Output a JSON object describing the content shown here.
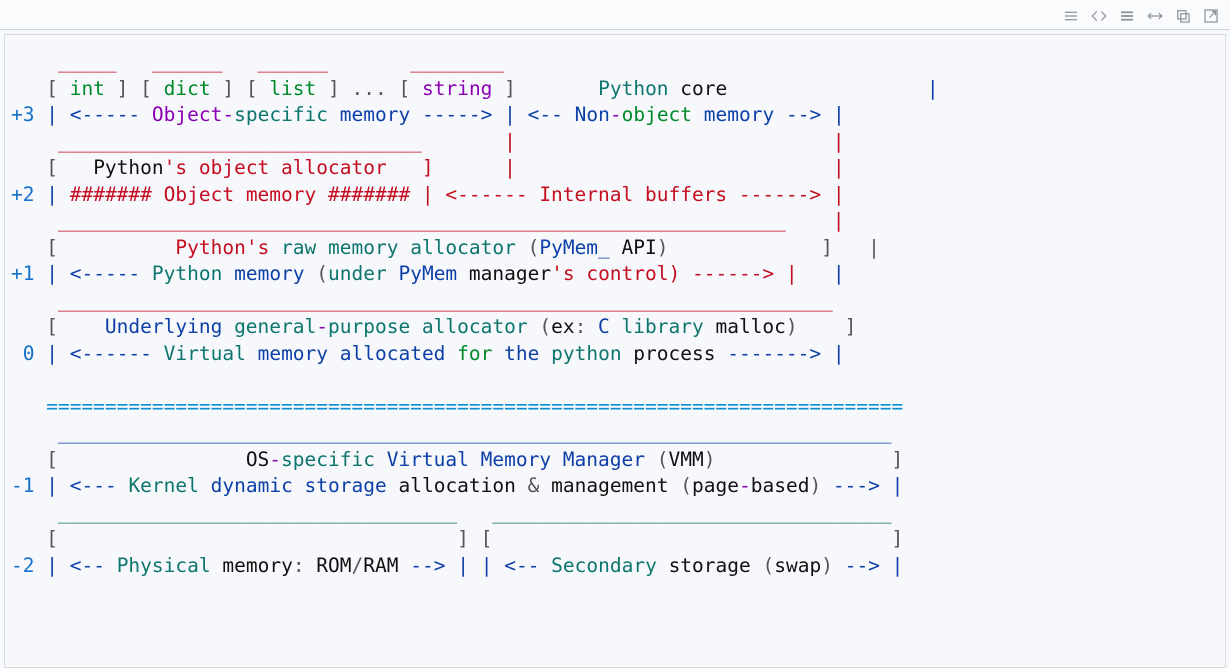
{
  "toolbar": {
    "icons": [
      "hamburger",
      "code",
      "stack",
      "expand-h",
      "copy",
      "popout"
    ]
  },
  "code": {
    "line01": "    _____   ______   ______       ________",
    "line02a": "   [ ",
    "line02b": "int",
    "line02c": " ] [ ",
    "line02d": "dict",
    "line02e": " ] [ ",
    "line02f": "list",
    "line02g": " ] ",
    "line02h": "...",
    "line02i": " [ ",
    "line02j": "string",
    "line02k": " ]       ",
    "line02l": "Python",
    "line02m": " core",
    "line02n": "                 |",
    "line03a": "+3",
    "line03b": " | ",
    "line03c": "<",
    "line03d": "-----",
    "line03e": " Object",
    "line03f": "-",
    "line03g": "specific",
    "line03h": " memory ",
    "line03i": "----->",
    "line03j": " | ",
    "line03k": "<",
    "line03l": "--",
    "line03m": " Non",
    "line03n": "-",
    "line03o": "object",
    "line03p": " memory ",
    "line03q": "-->",
    "line03r": " |",
    "line04a": "    _______________________________       |                           |",
    "line04b_lead": "   [   ",
    "line04b_py": "Python",
    "line04b_s": "'s object allocator   ]      |                           |",
    "line06a": "+2",
    "line06b": " | ",
    "line06c": "####### Object memory ####### | <------ Internal buffers ------> |",
    "line07": "    ______________________________________________________________    |",
    "line08a": "   [          ",
    "line08b": "Python",
    "line08c": "'s",
    "line08d": " raw memory allocator",
    "line08e": " (",
    "line08f": "PyMem_",
    "line08g": " API",
    "line08h": ")             ]   |",
    "line09a": "+1",
    "line09b": " | ",
    "line09c": "<",
    "line09d": "-----",
    "line09e": " Python",
    "line09f": " memory ",
    "line09g": "(",
    "line09h": "under",
    "line09i": " PyMem",
    "line09j": " manager",
    "line09k": "'s control) ------> | ",
    "line09l": "  |",
    "line10": "    __________________________________________________________________",
    "line11a": "   [    ",
    "line11b": "Underlying",
    "line11c": " general",
    "line11d": "-",
    "line11e": "purpose",
    "line11f": " allocator",
    "line11g": " (",
    "line11h": "ex",
    "line11i": ":",
    "line11j": " C",
    "line11k": " library",
    "line11l": " malloc",
    "line11m": ")    ]",
    "line12a": " 0",
    "line12b": " | ",
    "line12c": "<",
    "line12d": "------",
    "line12e": " Virtual",
    "line12f": " memory allocated ",
    "line12g": "for",
    "line12h": " the",
    "line12i": " python",
    "line12j": " process ",
    "line12k": "------->",
    "line12l": " |",
    "line13": "",
    "line14": "   =========================================================================",
    "line15": "    _______________________________________________________________________",
    "line16a": "   [                ",
    "line16b": "OS",
    "line16c": "-",
    "line16d": "specific",
    "line16e": " Virtual Memory Manager ",
    "line16f": "(",
    "line16g": "VMM",
    "line16h": ")               ]",
    "line17a": "-1",
    "line17b": " | ",
    "line17c": "<",
    "line17d": "---",
    "line17e": " Kernel",
    "line17f": " dynamic storage ",
    "line17g": "allocation ",
    "line17h": "&",
    "line17i": " management ",
    "line17j": "(",
    "line17k": "page",
    "line17l": "-",
    "line17m": "based",
    "line17n": ") ",
    "line17o": "--->",
    "line17p": " |",
    "line18": "    __________________________________   __________________________________",
    "line19a": "   [                                  ] [                                  ]",
    "line20a": "-2",
    "line20b": " | ",
    "line20c": "<",
    "line20d": "--",
    "line20e": " Physical",
    "line20f": " memory",
    "line20g": ":",
    "line20h": " ROM",
    "line20i": "/",
    "line20j": "RAM ",
    "line20k": "-->",
    "line20l": " | | ",
    "line20m": "<",
    "line20n": "--",
    "line20o": " Secondary",
    "line20p": " storage ",
    "line20q": "(",
    "line20r": "swap",
    "line20s": ") ",
    "line20t": "-->",
    "line20u": " |"
  }
}
